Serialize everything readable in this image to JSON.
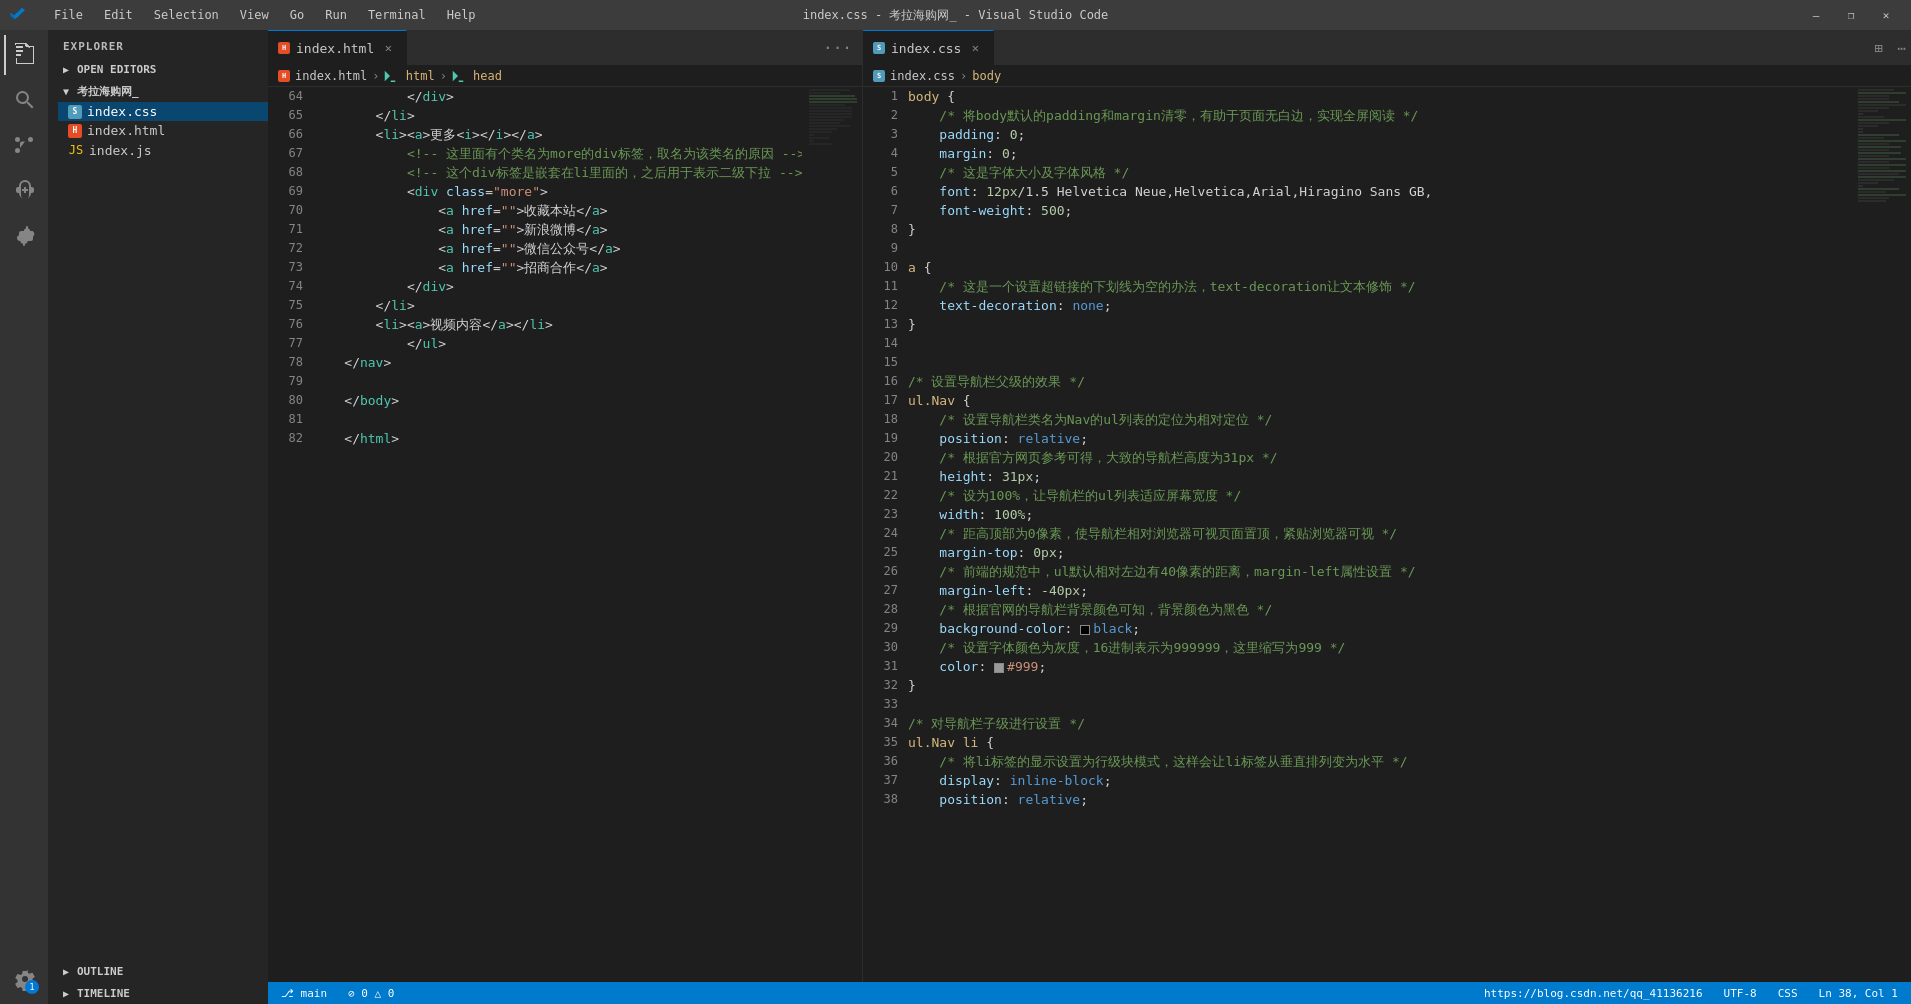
{
  "titleBar": {
    "title": "index.css - 考拉海购网_ - Visual Studio Code",
    "menuItems": [
      "File",
      "Edit",
      "Selection",
      "View",
      "Go",
      "Run",
      "Terminal",
      "Help"
    ],
    "windowButtons": [
      "—",
      "❐",
      "✕"
    ]
  },
  "activityBar": {
    "icons": [
      "explorer",
      "search",
      "source-control",
      "debug",
      "extensions"
    ],
    "bottomIcons": [
      "settings"
    ],
    "badge": "1"
  },
  "sidebar": {
    "title": "EXPLORER",
    "sections": [
      {
        "name": "OPEN EDITORS",
        "expanded": false
      },
      {
        "name": "考拉海购网_",
        "expanded": true,
        "files": [
          {
            "name": "index.css",
            "type": "css",
            "active": true
          },
          {
            "name": "index.html",
            "type": "html"
          },
          {
            "name": "index.js",
            "type": "js"
          }
        ]
      }
    ],
    "outline": "OUTLINE",
    "timeline": "TIMELINE"
  },
  "leftEditor": {
    "tab": {
      "icon": "html",
      "name": "index.html",
      "dirty": false
    },
    "breadcrumb": [
      "index.html",
      "html",
      "head"
    ],
    "startLine": 64,
    "lines": [
      {
        "num": 64,
        "content": "            </div>"
      },
      {
        "num": 65,
        "content": "        </li>"
      },
      {
        "num": 66,
        "content": "        <li><a>更多<i></i></a>"
      },
      {
        "num": 67,
        "content": "            <!-- 这里面有个类名为more的div标签，取名为该类名的原因 -->"
      },
      {
        "num": 68,
        "content": "            <!-- 这个div标签是嵌套在li里面的，之后用于表示二级下拉 -->"
      },
      {
        "num": 69,
        "content": "            <div class=\"more\">"
      },
      {
        "num": 70,
        "content": "                <a href=\"\">收藏本站</a>"
      },
      {
        "num": 71,
        "content": "                <a href=\"\">新浪微博</a>"
      },
      {
        "num": 72,
        "content": "                <a href=\"\">微信公众号</a>"
      },
      {
        "num": 73,
        "content": "                <a href=\"\">招商合作</a>"
      },
      {
        "num": 74,
        "content": "            </div>"
      },
      {
        "num": 75,
        "content": "        </li>"
      },
      {
        "num": 76,
        "content": "        <li><a>视频内容</a></li>"
      },
      {
        "num": 77,
        "content": "        </ul>"
      },
      {
        "num": 78,
        "content": "    </nav>"
      },
      {
        "num": 79,
        "content": ""
      },
      {
        "num": 80,
        "content": "    </body>"
      },
      {
        "num": 81,
        "content": ""
      },
      {
        "num": 82,
        "content": "    </html>"
      }
    ]
  },
  "rightEditor": {
    "tab": {
      "icon": "css",
      "name": "index.css",
      "dirty": false
    },
    "breadcrumb": [
      "index.css",
      "body"
    ],
    "startLine": 1,
    "lines": [
      {
        "num": 1,
        "content": "body {"
      },
      {
        "num": 2,
        "content": "    /* 将body默认的padding和margin清零，有助于页面无白边，实现全屏阅读 */"
      },
      {
        "num": 3,
        "content": "    padding: 0;"
      },
      {
        "num": 4,
        "content": "    margin: 0;"
      },
      {
        "num": 5,
        "content": "    /* 这是字体大小及字体风格 */"
      },
      {
        "num": 6,
        "content": "    font: 12px/1.5 Helvetica Neue,Helvetica,Arial,Hiragino Sans GB,"
      },
      {
        "num": 7,
        "content": "    font-weight: 500;"
      },
      {
        "num": 8,
        "content": "}"
      },
      {
        "num": 9,
        "content": ""
      },
      {
        "num": 10,
        "content": "a {"
      },
      {
        "num": 11,
        "content": "    /* 这是一个设置超链接的下划线为空的办法，text-decoration让文本修饰 */"
      },
      {
        "num": 12,
        "content": "    text-decoration: none;"
      },
      {
        "num": 13,
        "content": "}"
      },
      {
        "num": 14,
        "content": ""
      },
      {
        "num": 15,
        "content": ""
      },
      {
        "num": 16,
        "content": "/* 设置导航栏父级的效果 */"
      },
      {
        "num": 17,
        "content": "ul.Nav {"
      },
      {
        "num": 18,
        "content": "    /* 设置导航栏类名为Nav的ul列表的定位为相对定位 */"
      },
      {
        "num": 19,
        "content": "    position: relative;"
      },
      {
        "num": 20,
        "content": "    /* 根据官方网页参考可得，大致的导航栏高度为31px */"
      },
      {
        "num": 21,
        "content": "    height: 31px;"
      },
      {
        "num": 22,
        "content": "    /* 设为100%，让导航栏的ul列表适应屏幕宽度 */"
      },
      {
        "num": 23,
        "content": "    width: 100%;"
      },
      {
        "num": 24,
        "content": "    /* 距高顶部为0像素，使导航栏相对浏览器可视页面置顶，紧贴浏览器可视 */"
      },
      {
        "num": 25,
        "content": "    margin-top: 0px;"
      },
      {
        "num": 26,
        "content": "    /* 前端的规范中，ul默认相对左边有40像素的距离，margin-left属性设置 */"
      },
      {
        "num": 27,
        "content": "    margin-left: -40px;"
      },
      {
        "num": 28,
        "content": "    /* 根据官网的导航栏背景颜色可知，背景颜色为黑色 */"
      },
      {
        "num": 29,
        "content": "    background-color: □black;"
      },
      {
        "num": 30,
        "content": "    /* 设置字体颜色为灰度，16进制表示为999999，这里缩写为999 */"
      },
      {
        "num": 31,
        "content": "    color: □#999;"
      },
      {
        "num": 32,
        "content": "}"
      },
      {
        "num": 33,
        "content": ""
      },
      {
        "num": 34,
        "content": "/* 对导航栏子级进行设置 */"
      },
      {
        "num": 35,
        "content": "ul.Nav li {"
      },
      {
        "num": 36,
        "content": "    /* 将li标签的显示设置为行级块模式，这样会让li标签从垂直排列变为水平 */"
      },
      {
        "num": 37,
        "content": "    display: inline-block;"
      },
      {
        "num": 38,
        "content": "    position: relative;"
      }
    ]
  },
  "statusBar": {
    "left": [
      "⎇ main",
      "0 errors, 0 warnings"
    ],
    "right": [
      "https://blog.csdn.net/qq_41136216",
      "UTF-8",
      "CSS",
      "Ln 38, Col 1"
    ],
    "url": "https://blog.csdn.net/qq_41136216"
  }
}
